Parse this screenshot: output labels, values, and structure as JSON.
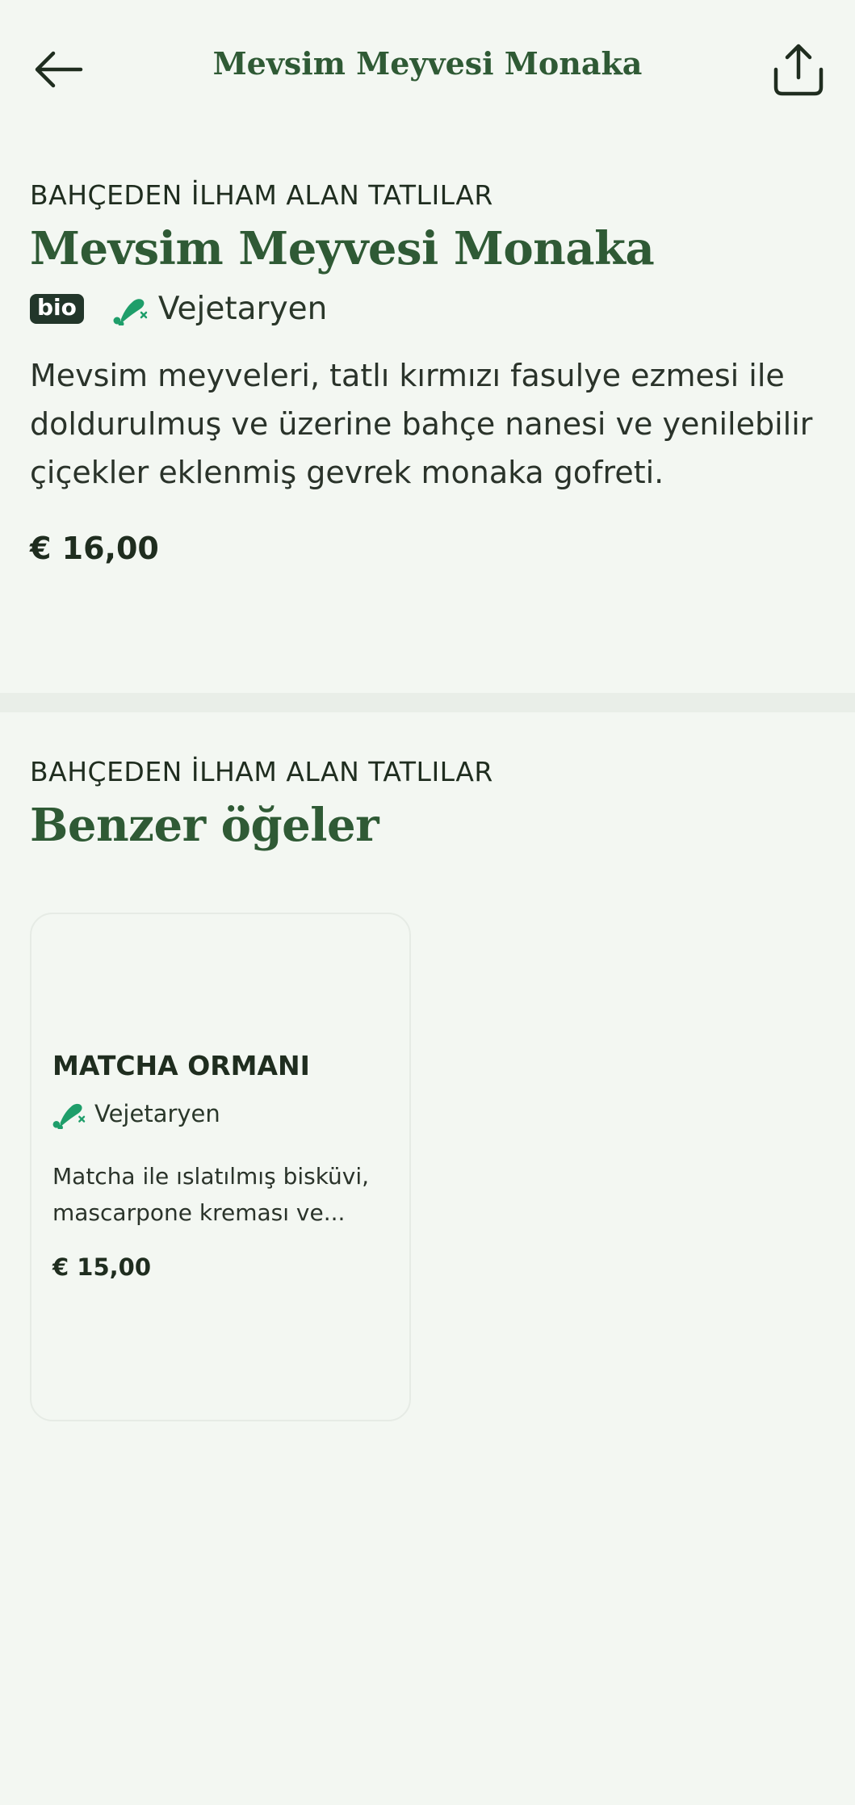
{
  "header": {
    "title": "Mevsim Meyvesi Monaka"
  },
  "product": {
    "category": "BAHÇEDEN İLHAM ALAN TATLILAR",
    "name": "Mevsim Meyvesi Monaka",
    "badge": "bio",
    "diet_label": "Vejetaryen",
    "description": "Mevsim meyveleri, tatlı kırmızı fasulye ezmesi ile doldurulmuş ve üzerine bahçe nanesi ve yenilebilir çiçekler eklenmiş gevrek monaka gofreti.",
    "price": "€ 16,00"
  },
  "similar": {
    "category": "BAHÇEDEN İLHAM ALAN TATLILAR",
    "title": "Benzer öğeler",
    "items": [
      {
        "name": "MATCHA ORMANI",
        "diet_label": "Vejetaryen",
        "description": "Matcha ile ıslatılmış bisküvi, mascarpone kreması ve...",
        "price": "€ 15,00"
      }
    ]
  },
  "colors": {
    "background": "#f3f7f2",
    "accent_green": "#2f5a35",
    "veg_icon": "#1e9e6a",
    "badge_bg": "#22362a"
  },
  "icons": {
    "back": "arrow-left-icon",
    "share": "share-icon",
    "vegetarian": "drumstick-crossed-icon"
  }
}
